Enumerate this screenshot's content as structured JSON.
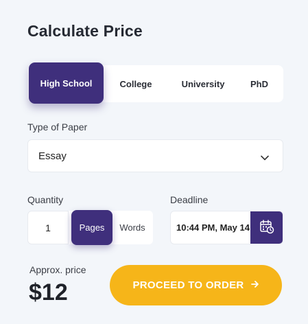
{
  "title": "Calculate Price",
  "levels": [
    "High School",
    "College",
    "University",
    "PhD"
  ],
  "active_level": "High School",
  "paper_type": {
    "label": "Type of Paper",
    "value": "Essay",
    "icon": "chevron-down-icon"
  },
  "quantity": {
    "label": "Quantity",
    "value": "1",
    "units": [
      "Pages",
      "Words"
    ],
    "active_unit": "Pages"
  },
  "deadline": {
    "label": "Deadline",
    "value": "10:44 PM, May 14",
    "icon": "calendar-clock-icon"
  },
  "price": {
    "label": "Approx. price",
    "value": "$12"
  },
  "cta": {
    "label": "PROCEED TO ORDER",
    "icon": "arrow-right-icon"
  },
  "colors": {
    "primary": "#3f2f7c",
    "accent": "#f6b519",
    "background": "#f3f6fa"
  }
}
